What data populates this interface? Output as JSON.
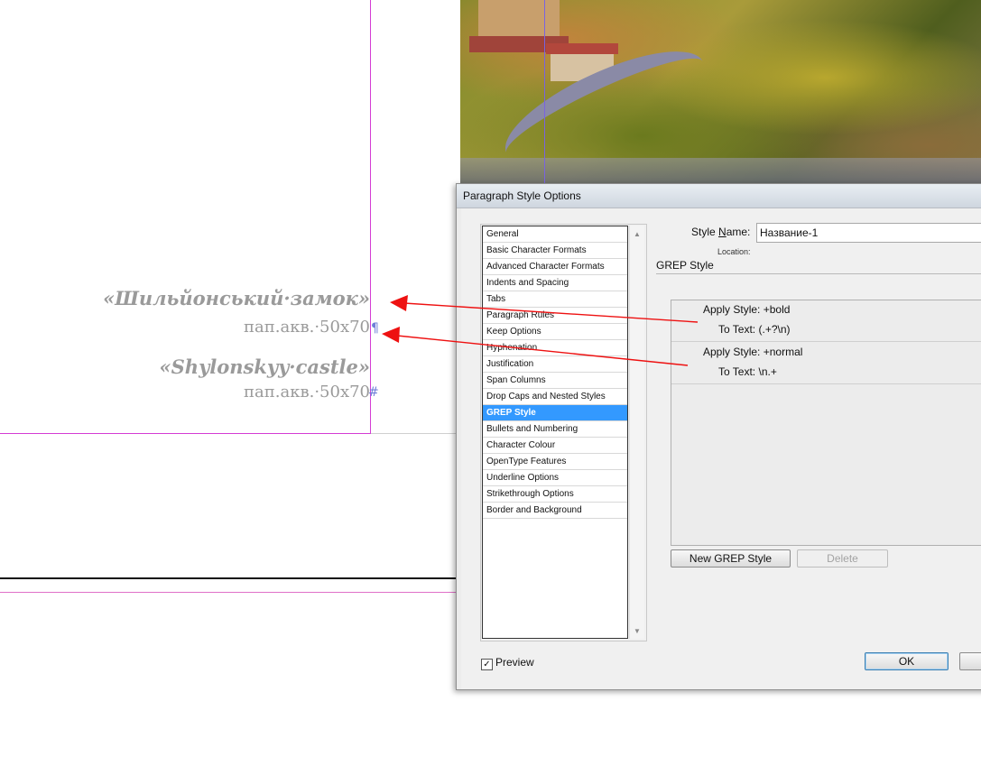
{
  "document": {
    "title_ua": "«Шильйонський·замок»",
    "medium_1": "пап.акв.·50х70",
    "title_en": "«Shylonskyy·castle»",
    "medium_2": "пап.акв.·50х70",
    "end_mark": "¶",
    "end_mark_2": "#",
    "end_mark_3": "»"
  },
  "dialog": {
    "title": "Paragraph Style Options",
    "categories": [
      "General",
      "Basic Character Formats",
      "Advanced Character Formats",
      "Indents and Spacing",
      "Tabs",
      "Paragraph Rules",
      "Keep Options",
      "Hyphenation",
      "Justification",
      "Span Columns",
      "Drop Caps and Nested Styles",
      "GREP Style",
      "Bullets and Numbering",
      "Character Colour",
      "OpenType Features",
      "Underline Options",
      "Strikethrough Options",
      "Border and Background"
    ],
    "selected_category": "GREP Style",
    "style_name_label_pre": "Style ",
    "style_name_label_u": "N",
    "style_name_label_post": "ame:",
    "style_name_value": "Название-1",
    "location_label": "Location:",
    "section_title": "GREP Style",
    "grep_styles": [
      {
        "apply_label": "Apply Style:",
        "apply_value": "+bold",
        "text_label": "To Text:",
        "text_value": "(.+?\\n)"
      },
      {
        "apply_label": "Apply Style:",
        "apply_value": "+normal",
        "text_label": "To Text:",
        "text_value": "\\n.+"
      }
    ],
    "new_grep_button": "New GREP Style",
    "delete_button": "Delete",
    "preview_label": "Preview",
    "preview_checked": true,
    "ok_button": "OK"
  },
  "colors": {
    "selection": "#3399ff",
    "arrow": "#ee1111",
    "guide": "#d43cd4"
  }
}
